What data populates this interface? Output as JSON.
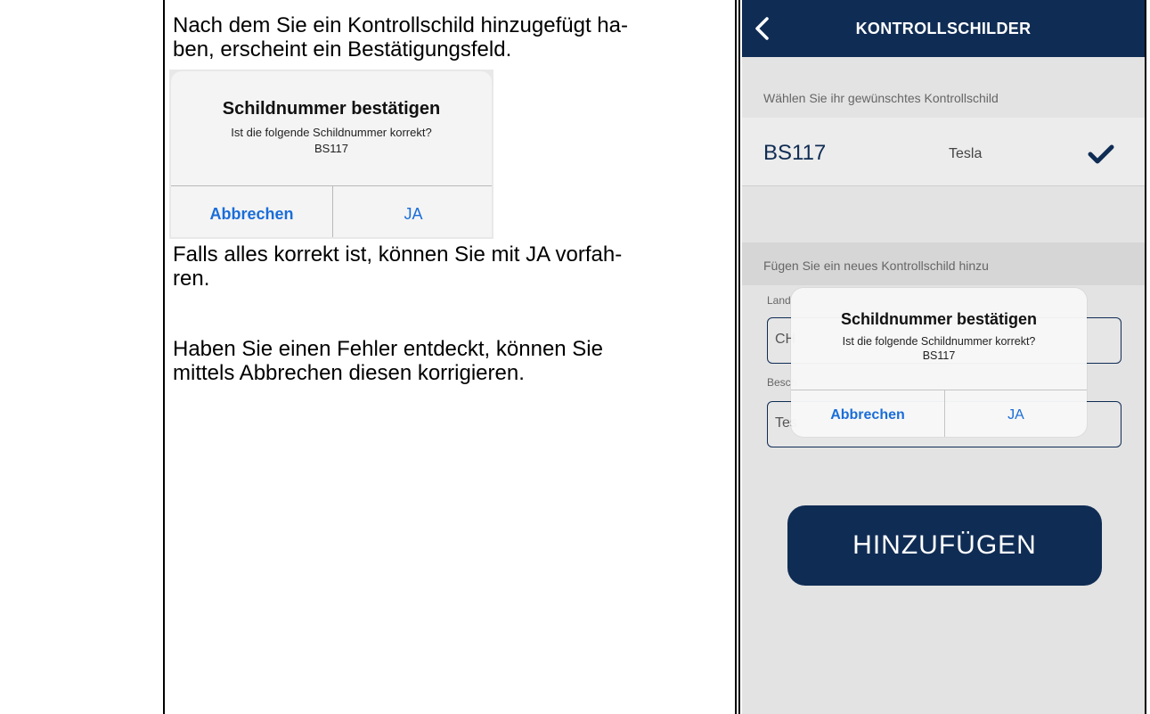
{
  "document": {
    "paragraph_1": "Nach dem Sie ein Kontrollschild hinzugefügt ha-\nben, erscheint ein Bestätigungsfeld.",
    "paragraph_2": "Falls alles korrekt ist, können Sie mit JA vorfah-\nren.",
    "paragraph_3": "Haben Sie einen Fehler entdeckt, können Sie\nmittels Abbrechen diesen korrigieren."
  },
  "mini_dialog": {
    "title": "Schildnummer bestätigen",
    "message": "Ist die folgende Schildnummer korrekt?\nBS117",
    "cancel_label": "Abbrechen",
    "confirm_label": "JA"
  },
  "app": {
    "nav_title": "KONTROLLSCHILDER",
    "back_icon": "chevron-left-icon",
    "select_section_label": "Wählen Sie ihr gewünschtes Kontrollschild",
    "selected_plate": {
      "number": "BS117",
      "description": "Tesla",
      "selected_icon": "checkmark-icon"
    },
    "add_section_label": "Fügen Sie ein neues Kontrollschild hinzu",
    "country_label": "Land",
    "country_value": "CH",
    "description_label": "Besch",
    "description_value": "Tes",
    "add_button_label": "HINZUFÜGEN",
    "dialog": {
      "title": "Schildnummer bestätigen",
      "message": "Ist die folgende Schildnummer korrekt?\nBS117",
      "cancel_label": "Abbrechen",
      "confirm_label": "JA"
    },
    "colors": {
      "nav_background": "#0f2c54",
      "accent_blue": "#1a6dd9",
      "screen_background": "#e3e3e3"
    }
  }
}
